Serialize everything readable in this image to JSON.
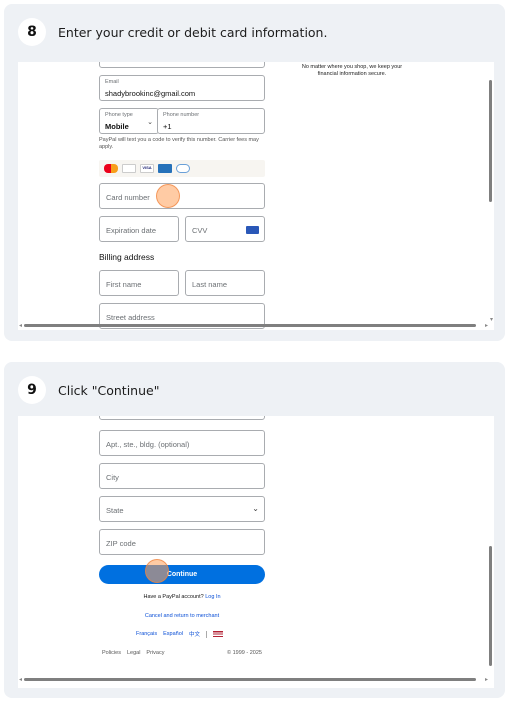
{
  "step8": {
    "number": "8",
    "title": "Enter your credit or debit card information.",
    "side_note": "No matter where you shop, we keep your financial information secure.",
    "email": {
      "label": "Email",
      "value": "shadybrookinc@gmail.com"
    },
    "phone_type": {
      "label": "Phone type",
      "value": "Mobile"
    },
    "phone_number": {
      "label": "Phone number",
      "value": "+1"
    },
    "phone_note": "PayPal will text you a code to verify this number. Carrier fees may apply.",
    "card_brands": [
      "mastercard-icon",
      "discover-icon",
      "visa-icon",
      "amex-icon",
      "diners-icon"
    ],
    "card_number_placeholder": "Card number",
    "expiration_placeholder": "Expiration date",
    "cvv_placeholder": "CVV",
    "billing_heading": "Billing address",
    "first_name_placeholder": "First name",
    "last_name_placeholder": "Last name",
    "street_placeholder": "Street address"
  },
  "step9": {
    "number": "9",
    "title": "Click \"Continue\"",
    "apt_placeholder": "Apt., ste., bldg. (optional)",
    "city_placeholder": "City",
    "state_placeholder": "State",
    "zip_placeholder": "ZIP code",
    "continue_label": "Continue",
    "have_account": "Have a PayPal account?",
    "login_link": "Log In",
    "cancel_link": "Cancel and return to merchant",
    "languages": [
      "Français",
      "Español",
      "中文"
    ],
    "footer_links": [
      "Policies",
      "Legal",
      "Privacy"
    ],
    "copyright": "© 1999 - 2025"
  },
  "colors": {
    "accent": "#0070e0",
    "link": "#0a4fd6",
    "click_marker": "#ffa05a"
  }
}
